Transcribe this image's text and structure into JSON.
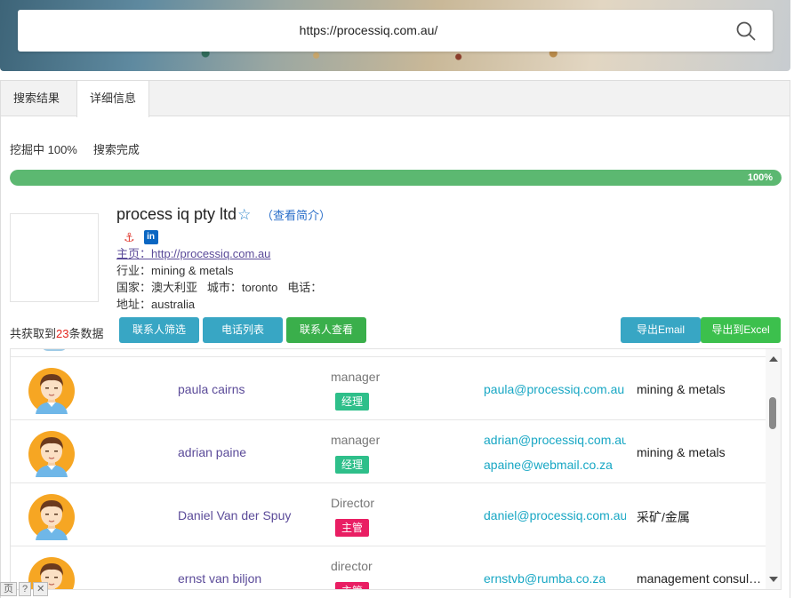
{
  "search": {
    "url": "https://processiq.com.au/"
  },
  "tabs": [
    {
      "label": "搜索结果"
    },
    {
      "label": "详细信息"
    }
  ],
  "status": {
    "mining": "挖掘中 100%",
    "done": "搜索完成"
  },
  "progress": {
    "percent": 100,
    "label": "100%"
  },
  "company": {
    "name": "process iq pty ltd",
    "intro_link": "（查看简介）",
    "homepage_label": "主页：",
    "homepage_url": "http://processiq.com.au",
    "industry_label": "行业：",
    "industry": "mining & metals",
    "country_label": "国家：",
    "country": "澳大利亚",
    "city_label": "城市：",
    "city": "toronto",
    "phone_label": "电话：",
    "address_label": "地址：",
    "address": "australia",
    "linkedin_icon_text": "in"
  },
  "summary": {
    "prefix": "共获取到",
    "count": "23",
    "suffix": "条数据"
  },
  "buttons": {
    "filter": "联系人筛选",
    "phone_list": "电话列表",
    "view_contacts": "联系人查看",
    "export_email": "导出Email",
    "export_excel": "导出到Excel"
  },
  "contacts": [
    {
      "name": "paula cairns",
      "title": "manager",
      "badge": "经理",
      "badge_color": "#2ebf8a",
      "emails": [
        "paula@processiq.com.au"
      ],
      "industry": "mining & metals"
    },
    {
      "name": "adrian paine",
      "title": "manager",
      "badge": "经理",
      "badge_color": "#2ebf8a",
      "emails": [
        "adrian@processiq.com.au",
        "apaine@webmail.co.za"
      ],
      "industry": "mining & metals"
    },
    {
      "name": "Daniel Van der Spuy",
      "title": "Director",
      "badge": "主管",
      "badge_color": "#e91e63",
      "emails": [
        "daniel@processiq.com.au"
      ],
      "industry": "采矿/金属"
    },
    {
      "name": "ernst van biljon",
      "title": "director",
      "badge": "主管",
      "badge_color": "#e91e63",
      "emails": [
        "ernstvb@rumba.co.za"
      ],
      "industry": "management consulting"
    }
  ],
  "tray": {
    "item1": "页",
    "item2": "?",
    "item3": "✕"
  },
  "colors": {
    "accent": "#38a6c4",
    "progress": "#5cb871",
    "link": "#5b4b99",
    "email": "#18a7c4"
  }
}
